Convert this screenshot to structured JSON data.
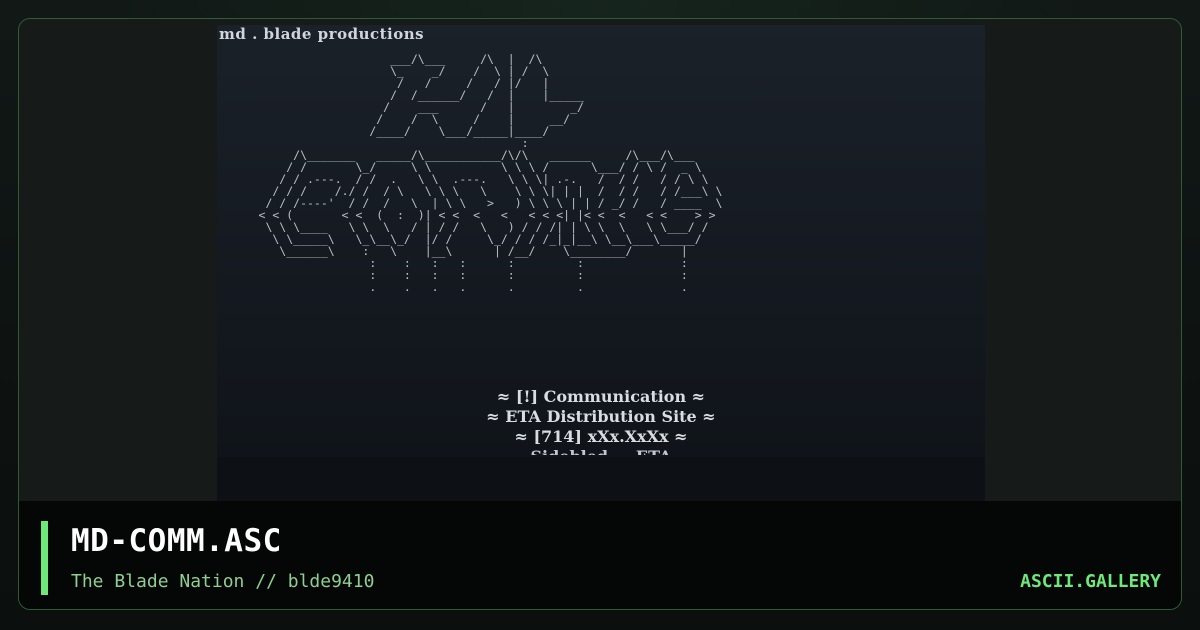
{
  "card": {
    "title": "MD-COMM.ASC",
    "subtitle": "The Blade Nation // blde9410",
    "site": "ASCII.GALLERY",
    "accent_color": "#6ee879",
    "border_color": "#2f5a36"
  },
  "screen": {
    "header": "md . blade productions",
    "ascii_lines": [
      "                         ___/\\___     /\\  |  /\\",
      "                         \\_    _/    /  \\ | /  \\",
      "                          /   /     /   / |/   |",
      "                         /  /______/   /  |    |_____",
      "                        /    ___      /   |        _/",
      "                       /    /  \\     /    |     __/",
      "                      /____/    \\___/_____|____/",
      "                                            :",
      "           /\\_______   _____/\\___________/\\/\\   ______     /\\___/\\___",
      "          / /       \\_/     \\ \\          \\ \\ \\ /      \\___/ / \\ /  _ \\",
      "         / / .---.  / /  .   \\ \\  .---.   \\ \\ \\| .-.   /  / /   / / \\ \\",
      "        / / /    /./ /  / \\   \\ \\ \\   \\    \\ \\ \\| | |  /  / /   / /___\\ \\",
      "       / / /----'  / /  /   \\  | \\ \\   >   ) \\ \\ \\ | | / _/ /   / ____  \\",
      "      < < (       < <  (  :  )| < <  <   <   < < <| |< <  <   < <    > >",
      "       \\ \\ \\____   \\ \\  \\   / | / /   \\   ) / / /| | \\ \\  \\   \\ \\___/ /",
      "        \\ \\_____\\   \\_\\__\\_/  |/ /     \\_/ / / /_|_|__\\ \\__\\___\\_____/",
      "         \\______\\    :   \\    |__\\      | /__/    \\________/       |",
      "                      :    :   :   :      :         :              :",
      "                      :    :   :   :      :         :              :",
      "                      .    .   .   .      .         .              ."
    ],
    "info_lines": [
      "≈ [!] Communication ≈",
      "≈ ETA Distribution Site ≈",
      "≈ [714] xXx.XxXx ≈",
      "Sidebled ... ETA"
    ]
  }
}
